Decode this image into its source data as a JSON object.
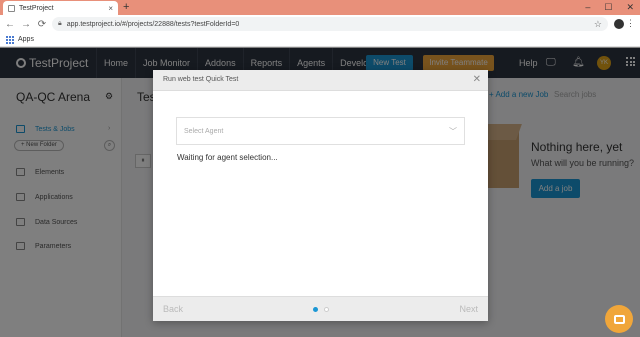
{
  "browser": {
    "tab_title": "TestProject",
    "tab_close": "×",
    "new_tab": "+",
    "window_controls": [
      "–",
      "☐",
      "✕"
    ],
    "url": "app.testproject.io/#/projects/22888/tests?testFolderId=0",
    "bookmarks_label": "Apps"
  },
  "header": {
    "logo_text": "TestProject",
    "nav": [
      "Home",
      "Job Monitor",
      "Addons",
      "Reports",
      "Agents",
      "Developers"
    ],
    "new_test_label": "New Test",
    "invite_label": "Invite Teammate",
    "help_label": "Help",
    "avatar_initials": "YK"
  },
  "sidebar": {
    "project_name": "QA-QC Arena",
    "items": [
      {
        "label": "Tests & Jobs"
      },
      {
        "label": "Elements"
      },
      {
        "label": "Applications"
      },
      {
        "label": "Data Sources"
      },
      {
        "label": "Parameters"
      }
    ],
    "new_folder_label": "+ New Folder"
  },
  "main": {
    "title_partial": "Tes",
    "add_job_label": "+ Add a new Job",
    "search_placeholder": "Search jobs",
    "empty_title": "Nothing here, yet",
    "empty_subtitle": "What will you be running?",
    "add_job_button": "Add a job"
  },
  "modal": {
    "title": "Run web test Quick Test",
    "close": "✕",
    "select_placeholder": "Select Agent",
    "status_text": "Waiting for agent selection...",
    "back_label": "Back",
    "next_label": "Next",
    "steps_total": 2,
    "step_current": 1
  },
  "colors": {
    "accent": "#1b97d4",
    "invite": "#f0a63a",
    "header_bg": "#2d3440",
    "tabbar_bg": "#e8907a"
  }
}
